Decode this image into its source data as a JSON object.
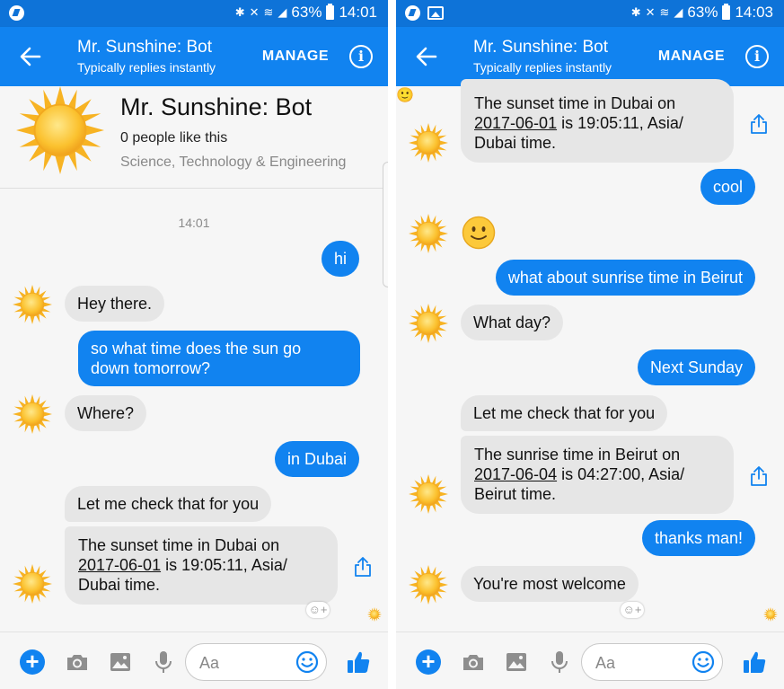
{
  "colors": {
    "brand": "#1183f0",
    "statusbar": "#0e73d8",
    "incoming_bubble": "#e6e6e6",
    "sun": "#fbbf2d"
  },
  "left": {
    "status": {
      "battery": "63%",
      "time": "14:01"
    },
    "appbar": {
      "title": "Mr. Sunshine: Bot",
      "subtitle": "Typically replies instantly",
      "manage": "MANAGE"
    },
    "profile": {
      "name": "Mr. Sunshine: Bot",
      "likes": "0 people like this",
      "category": "Science, Technology & Engineering"
    },
    "timestamp": "14:01",
    "messages": {
      "m1": "hi",
      "m2": "Hey there.",
      "m3a": "so what time does the sun go",
      "m3b": "down tomorrow?",
      "m4": "Where?",
      "m5": "in Dubai",
      "m6": "Let me check that for you",
      "m7a": "The sunset time in Dubai on",
      "m7b_date": "2017-06-01",
      "m7b_rest": " is 19:05:11, Asia/",
      "m7c": "Dubai time."
    },
    "input": {
      "placeholder": "Aa"
    }
  },
  "right": {
    "status": {
      "battery": "63%",
      "time": "14:03"
    },
    "appbar": {
      "title": "Mr. Sunshine: Bot",
      "subtitle": "Typically replies instantly",
      "manage": "MANAGE"
    },
    "messages": {
      "r1a": "The sunset time in Dubai on",
      "r1b_date": "2017-06-01",
      "r1b_rest": " is 19:05:11, Asia/",
      "r1c": "Dubai time.",
      "r2": "cool",
      "r3_emoji": "🙂",
      "r4": "what about sunrise time in Beirut",
      "r5": "What day?",
      "r6": "Next Sunday",
      "r7": "Let me check that for you",
      "r8a": "The sunrise time in Beirut on",
      "r8b_date": "2017-06-04",
      "r8b_rest": " is 04:27:00, Asia/",
      "r8c": "Beirut time.",
      "r9": "thanks man!",
      "r10": "You're most welcome"
    },
    "input": {
      "placeholder": "Aa"
    }
  },
  "icons": [
    "back-arrow-icon",
    "info-icon",
    "sun-avatar-icon",
    "share-icon",
    "add-reaction-icon",
    "plus-icon",
    "camera-icon",
    "image-icon",
    "microphone-icon",
    "emoji-icon",
    "thumbs-up-icon"
  ]
}
